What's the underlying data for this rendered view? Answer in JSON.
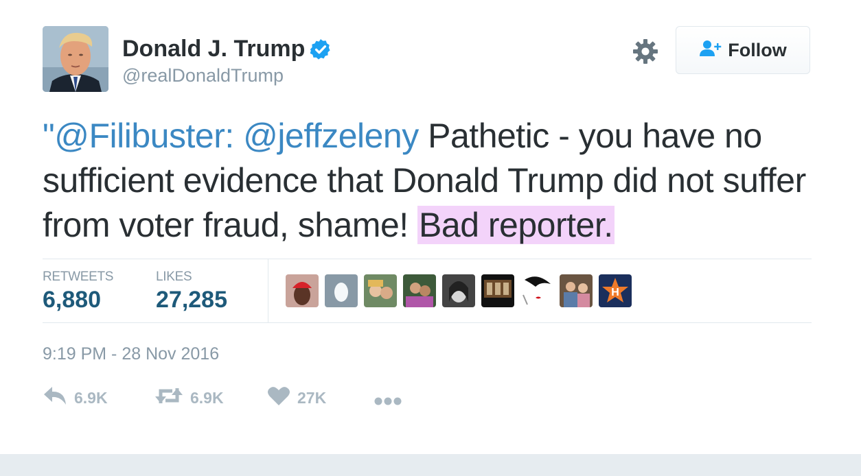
{
  "user": {
    "name": "Donald J. Trump",
    "handle": "@realDonaldTrump",
    "follow_label": "Follow"
  },
  "tweet": {
    "quote_open": "\"",
    "mention1": "@Filibuster",
    "colon": ":",
    "mention2": "@jeffzeleny",
    "body": " Pathetic - you have no sufficient evidence that Donald Trump did not suffer from voter fraud, shame! ",
    "highlight": "Bad reporter."
  },
  "stats": {
    "retweets_label": "RETWEETS",
    "retweets_value": "6,880",
    "likes_label": "LIKES",
    "likes_value": "27,285"
  },
  "timestamp": "9:19 PM - 28 Nov 2016",
  "actions": {
    "reply_count": "6.9K",
    "retweet_count": "6.9K",
    "like_count": "27K"
  },
  "colors": {
    "link": "#3b88c3",
    "highlight": "#f3d3fa",
    "verified": "#1da1f2",
    "muted": "#8899a6"
  }
}
